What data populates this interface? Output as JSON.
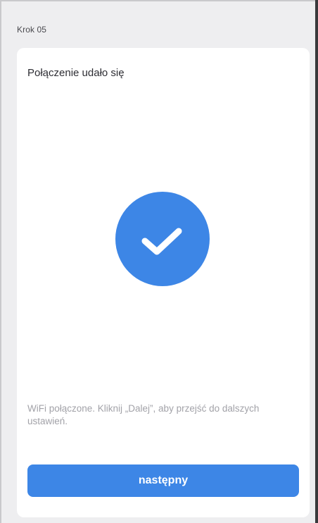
{
  "header": {
    "step_label": "Krok 05"
  },
  "card": {
    "title": "Połączenie udało się",
    "status_icon": "checkmark-circle-icon",
    "info_text": "WiFi połączone. Kliknij „Dalej”, aby przejść do dalszych ustawień.",
    "next_button_label": "następny"
  },
  "colors": {
    "accent": "#3d86e6",
    "background": "#eeeef0",
    "card": "#ffffff",
    "muted_text": "#a2a2a8",
    "title_text": "#2d2d33"
  }
}
